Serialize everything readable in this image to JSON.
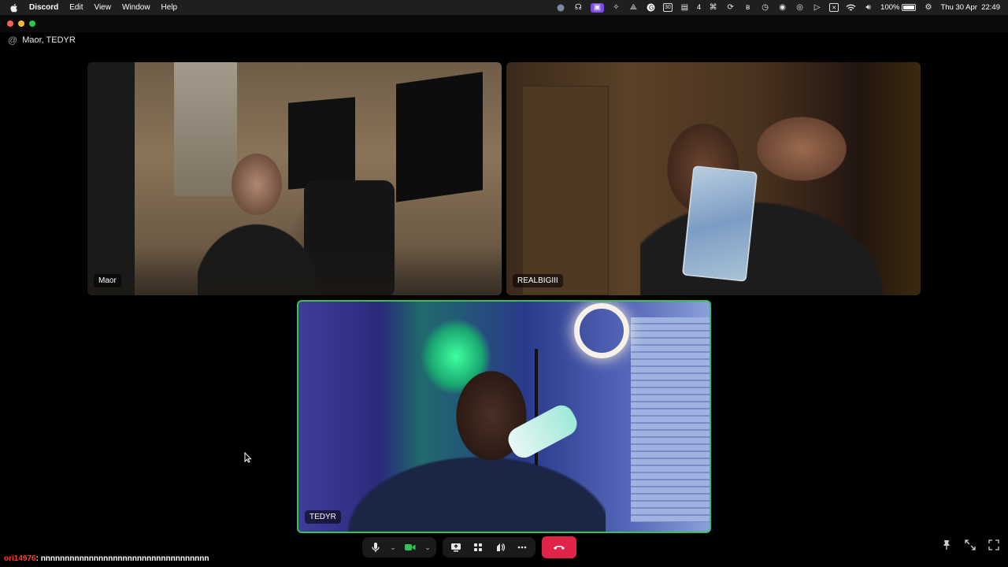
{
  "menubar": {
    "app_name": "Discord",
    "menus": [
      "Edit",
      "View",
      "Window",
      "Help"
    ],
    "status_icons": [
      "dot-icon",
      "headphones-icon",
      "screen-record-icon",
      "sparkle-icon",
      "rocket-icon",
      "grammar-icon",
      "calendar-icon",
      "notes-icon",
      "command-icon",
      "sync-icon",
      "bluetooth-icon",
      "clock-icon",
      "eye-icon",
      "vpn-icon",
      "play-icon",
      "x-icon",
      "wifi-icon",
      "volume-icon",
      "battery-icon",
      "control-center-icon"
    ],
    "notes_count": "4",
    "battery_percent": "100%",
    "datetime": "Thu 30 Apr  22:49"
  },
  "window": {
    "header_title": "Maor, TEDYR"
  },
  "tiles": [
    {
      "name": "Maor"
    },
    {
      "name": "REALBIGIII"
    },
    {
      "name": "TEDYR",
      "speaking": true
    }
  ],
  "overlay_chat": {
    "user": "ori14976",
    "message": ": nnnnnnnnnnnnnnnnnnnnnnnnnnnnnnnnnnn"
  },
  "colors": {
    "speaking_border": "#3bbf5c",
    "hangup": "#e0244a",
    "camera_on": "#3bbf5c"
  }
}
